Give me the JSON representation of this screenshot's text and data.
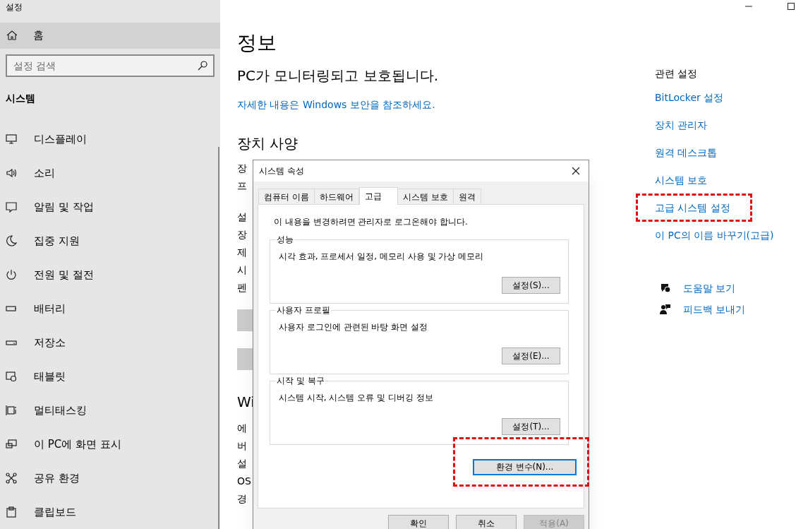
{
  "window": {
    "title": "설정"
  },
  "sidebar": {
    "home": "홈",
    "search": {
      "placeholder": "설정 검색"
    },
    "section": "시스템",
    "items": [
      {
        "label": "디스플레이"
      },
      {
        "label": "소리"
      },
      {
        "label": "알림 및 작업"
      },
      {
        "label": "집중 지원"
      },
      {
        "label": "전원 및 절전"
      },
      {
        "label": "배터리"
      },
      {
        "label": "저장소"
      },
      {
        "label": "태블릿"
      },
      {
        "label": "멀티태스킹"
      },
      {
        "label": "이 PC에 화면 표시"
      },
      {
        "label": "공유 환경"
      },
      {
        "label": "클립보드"
      }
    ]
  },
  "main": {
    "title": "정보",
    "status": "PC가 모니터링되고 보호됩니다.",
    "security_link": "자세한 내용은 Windows 보안을 참조하세요.",
    "spec_heading": "장치 사양",
    "spec_rows_1": [
      "장",
      "프"
    ],
    "spec_rows_2": [
      "설",
      "장",
      "제",
      "시",
      "펜"
    ],
    "windows_heading": "Wi",
    "windows_rows": [
      "에",
      "버",
      "설",
      "OS",
      "경"
    ]
  },
  "dialog": {
    "title": "시스템 속성",
    "tabs": [
      {
        "label": "컴퓨터 이름",
        "selected": false
      },
      {
        "label": "하드웨어",
        "selected": false
      },
      {
        "label": "고급",
        "selected": true
      },
      {
        "label": "시스템 보호",
        "selected": false
      },
      {
        "label": "원격",
        "selected": false
      }
    ],
    "notice": "이 내용을 변경하려면 관리자로 로그온해야 합니다.",
    "groups": [
      {
        "title": "성능",
        "description": "시각 효과, 프로세서 일정, 메모리 사용 및 가상 메모리",
        "button": "설정(S)..."
      },
      {
        "title": "사용자 프로필",
        "description": "사용자 로그인에 관련된 바탕 화면 설정",
        "button": "설정(E)..."
      },
      {
        "title": "시작 및 복구",
        "description": "시스템 시작, 시스템 오류 및 디버깅 정보",
        "button": "설정(T)..."
      }
    ],
    "env_button": {
      "label": "환경 변수(N)...",
      "focused": true,
      "highlighted": true
    },
    "buttons": [
      {
        "label": "확인",
        "disabled": false
      },
      {
        "label": "취소",
        "disabled": false
      },
      {
        "label": "적용(A)",
        "disabled": true
      }
    ]
  },
  "related": {
    "title": "관련 설정",
    "links": [
      {
        "label": "BitLocker 설정",
        "highlighted": false
      },
      {
        "label": "장치 관리자",
        "highlighted": false
      },
      {
        "label": "원격 데스크톱",
        "highlighted": false
      },
      {
        "label": "시스템 보호",
        "highlighted": false
      },
      {
        "label": "고급 시스템 설정",
        "highlighted": true
      },
      {
        "label": "이 PC의 이름 바꾸기(고급)",
        "highlighted": false
      }
    ],
    "support": [
      {
        "label": "도움말 보기"
      },
      {
        "label": "피드백 보내기"
      }
    ]
  }
}
